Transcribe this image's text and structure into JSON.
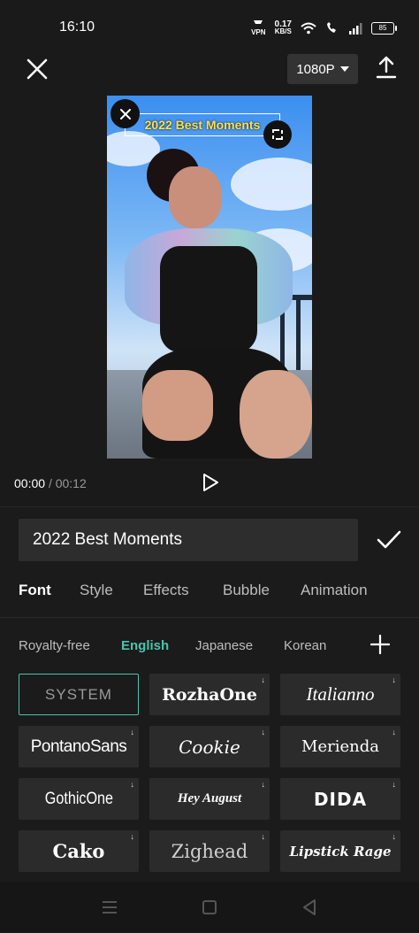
{
  "status_bar": {
    "time": "16:10",
    "vpn": "VPN",
    "speed_value": "0.17",
    "speed_unit": "KB/S",
    "battery": "85"
  },
  "toolbar": {
    "resolution": "1080P"
  },
  "preview": {
    "overlay_text": "2022 Best Moments"
  },
  "playback": {
    "current_time": "00:00",
    "separator": "/",
    "total_time": "00:12"
  },
  "editor": {
    "text_value": "2022 Best Moments",
    "tabs": [
      "Font",
      "Style",
      "Effects",
      "Bubble",
      "Animation"
    ],
    "categories": [
      "Royalty-free",
      "English",
      "Japanese",
      "Korean"
    ],
    "fonts": [
      "SYSTEM",
      "RozhaOne",
      "Italianno",
      "PontanoSans",
      "Cookie",
      "Merienda",
      "GothicOne",
      "Hey August",
      "DIDA",
      "Cako",
      "Zighead",
      "Lipstick Rage"
    ]
  },
  "colors": {
    "accent": "#4bc3ad",
    "overlay_text": "#ffe24a"
  }
}
